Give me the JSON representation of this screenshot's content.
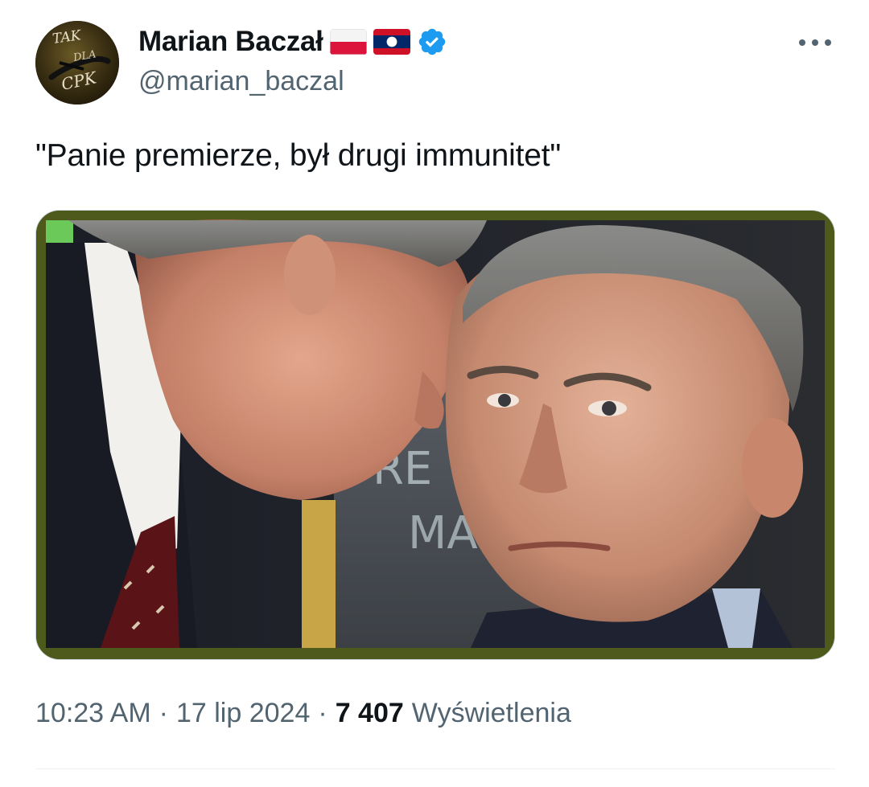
{
  "author": {
    "name": "Marian Baczał",
    "handle": "@marian_baczal",
    "avatar_text": [
      "TAK",
      "DLA",
      "CPK"
    ],
    "flags": [
      "poland-flag",
      "laos-flag"
    ],
    "verified": true
  },
  "tweet": {
    "text": "\"Panie premierze, był drugi immunitet\""
  },
  "media": {
    "background_text": [
      "RE",
      "MA"
    ]
  },
  "meta": {
    "time": "10:23 AM",
    "separator": "·",
    "date": "17 lip 2024",
    "views_count": "7 407",
    "views_label": "Wyświetlenia"
  },
  "colors": {
    "text_primary": "#0f1419",
    "text_secondary": "#536471",
    "verified_blue": "#1d9bf0",
    "media_frame": "#4d5a1c"
  }
}
